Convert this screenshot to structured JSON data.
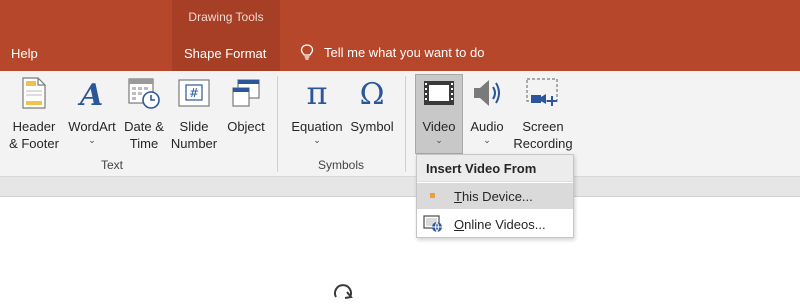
{
  "titlebar": {
    "contextual_group": "Drawing Tools",
    "tabs": [
      "Help",
      "Shape Format"
    ],
    "tell_me": "Tell me what you want to do"
  },
  "ribbon": {
    "text_group": {
      "label": "Text",
      "buttons": [
        "Header\n& Footer",
        "WordArt",
        "Date &\nTime",
        "Slide\nNumber",
        "Object"
      ]
    },
    "symbols_group": {
      "label": "Symbols",
      "buttons": [
        "Equation",
        "Symbol"
      ]
    },
    "media_group": {
      "buttons": [
        "Video",
        "Audio",
        "Screen\nRecording"
      ]
    },
    "slide_number_glyph": "#",
    "equation_glyph": "π",
    "symbol_glyph": "Ω"
  },
  "dropdown": {
    "title": "Insert Video From",
    "items": [
      {
        "prefix": "T",
        "rest": "his Device..."
      },
      {
        "prefix": "O",
        "rest": "nline Videos..."
      }
    ]
  },
  "colors": {
    "accent": "#b7472a",
    "ribbon": "#f3f3f3",
    "icon_blue": "#2b579a"
  }
}
